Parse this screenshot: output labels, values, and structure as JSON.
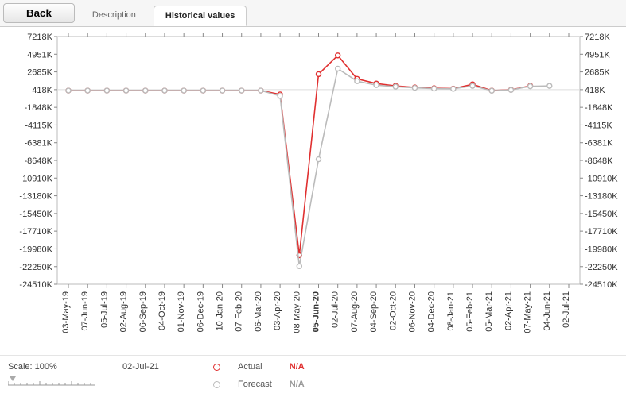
{
  "toolbar": {
    "back_label": "Back",
    "tabs": [
      {
        "label": "Description",
        "active": false
      },
      {
        "label": "Historical values",
        "active": true
      }
    ]
  },
  "footer": {
    "scale_label": "Scale:",
    "scale_value": "100%",
    "hover_date": "02-Jul-21",
    "legend": [
      {
        "key": "actual",
        "label": "Actual",
        "value": "N/A",
        "color": "#e03030"
      },
      {
        "key": "forecast",
        "label": "Forecast",
        "value": "N/A",
        "color": "#bbbbbb"
      }
    ]
  },
  "chart_data": {
    "type": "line",
    "xlabel": "",
    "ylabel": "",
    "ylim": [
      -24510,
      7218
    ],
    "y_ticks": [
      7218,
      4951,
      2685,
      418,
      -1848,
      -4115,
      -6381,
      -8648,
      -10910,
      -13180,
      -15450,
      -17710,
      -19980,
      -22250,
      -24510
    ],
    "y_tick_labels": [
      "7218K",
      "4951K",
      "2685K",
      "418K",
      "-1848K",
      "-4115K",
      "-6381K",
      "-8648K",
      "-10910K",
      "-13180K",
      "-15450K",
      "-17710K",
      "-19980K",
      "-22250K",
      "-24510K"
    ],
    "x_categories": [
      "03-May-19",
      "07-Jun-19",
      "05-Jul-19",
      "02-Aug-19",
      "06-Sep-19",
      "04-Oct-19",
      "01-Nov-19",
      "06-Dec-19",
      "10-Jan-20",
      "07-Feb-20",
      "06-Mar-20",
      "03-Apr-20",
      "08-May-20",
      "05-Jun-20",
      "02-Jul-20",
      "07-Aug-20",
      "04-Sep-20",
      "02-Oct-20",
      "06-Nov-20",
      "04-Dec-20",
      "08-Jan-21",
      "05-Feb-21",
      "05-Mar-21",
      "02-Apr-21",
      "07-May-21",
      "04-Jun-21",
      "02-Jul-21"
    ],
    "x_bold_index": 13,
    "series": [
      {
        "name": "Actual",
        "color": "#e03030",
        "values": [
          300,
          300,
          300,
          300,
          300,
          300,
          300,
          300,
          300,
          300,
          300,
          -200,
          -20800,
          2400,
          4800,
          1800,
          1200,
          900,
          700,
          600,
          550,
          1100,
          300,
          400,
          900,
          null,
          null
        ]
      },
      {
        "name": "Forecast",
        "color": "#bbbbbb",
        "values": [
          300,
          300,
          300,
          300,
          300,
          300,
          300,
          300,
          300,
          300,
          300,
          -400,
          -22200,
          -8500,
          3100,
          1500,
          1000,
          800,
          650,
          550,
          520,
          900,
          280,
          380,
          850,
          900,
          null
        ]
      }
    ]
  }
}
